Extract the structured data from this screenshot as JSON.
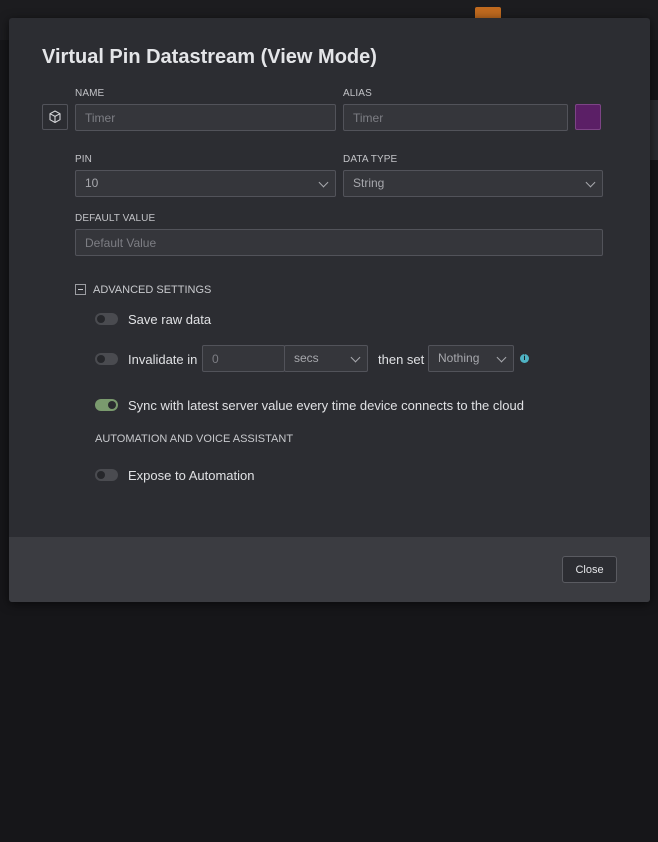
{
  "modal": {
    "title": "Virtual Pin Datastream (View Mode)",
    "name": {
      "label": "NAME",
      "placeholder": "Timer"
    },
    "alias": {
      "label": "ALIAS",
      "placeholder": "Timer"
    },
    "color_swatch": "#5b1f66",
    "pin": {
      "label": "PIN",
      "value": "10"
    },
    "data_type": {
      "label": "DATA TYPE",
      "value": "String"
    },
    "default_value": {
      "label": "DEFAULT VALUE",
      "placeholder": "Default Value"
    },
    "advanced": {
      "label": "ADVANCED SETTINGS",
      "save_raw": {
        "label": "Save raw data",
        "on": false
      },
      "invalidate": {
        "label": "Invalidate in",
        "value_placeholder": "0",
        "unit": "secs",
        "then_set_label": "then set",
        "then_set_value": "Nothing",
        "on": false
      },
      "sync": {
        "label": "Sync with latest server value every time device connects to the cloud",
        "on": true
      }
    },
    "automation": {
      "heading": "AUTOMATION AND VOICE ASSISTANT",
      "expose": {
        "label": "Expose to Automation",
        "on": false
      }
    },
    "footer": {
      "close_label": "Close"
    }
  },
  "colors": {
    "accent_on": "#7a9a6e",
    "background": "#161619",
    "modal": "#2c2d32",
    "footer": "#3b3c41",
    "info": "#4fb3c4"
  }
}
